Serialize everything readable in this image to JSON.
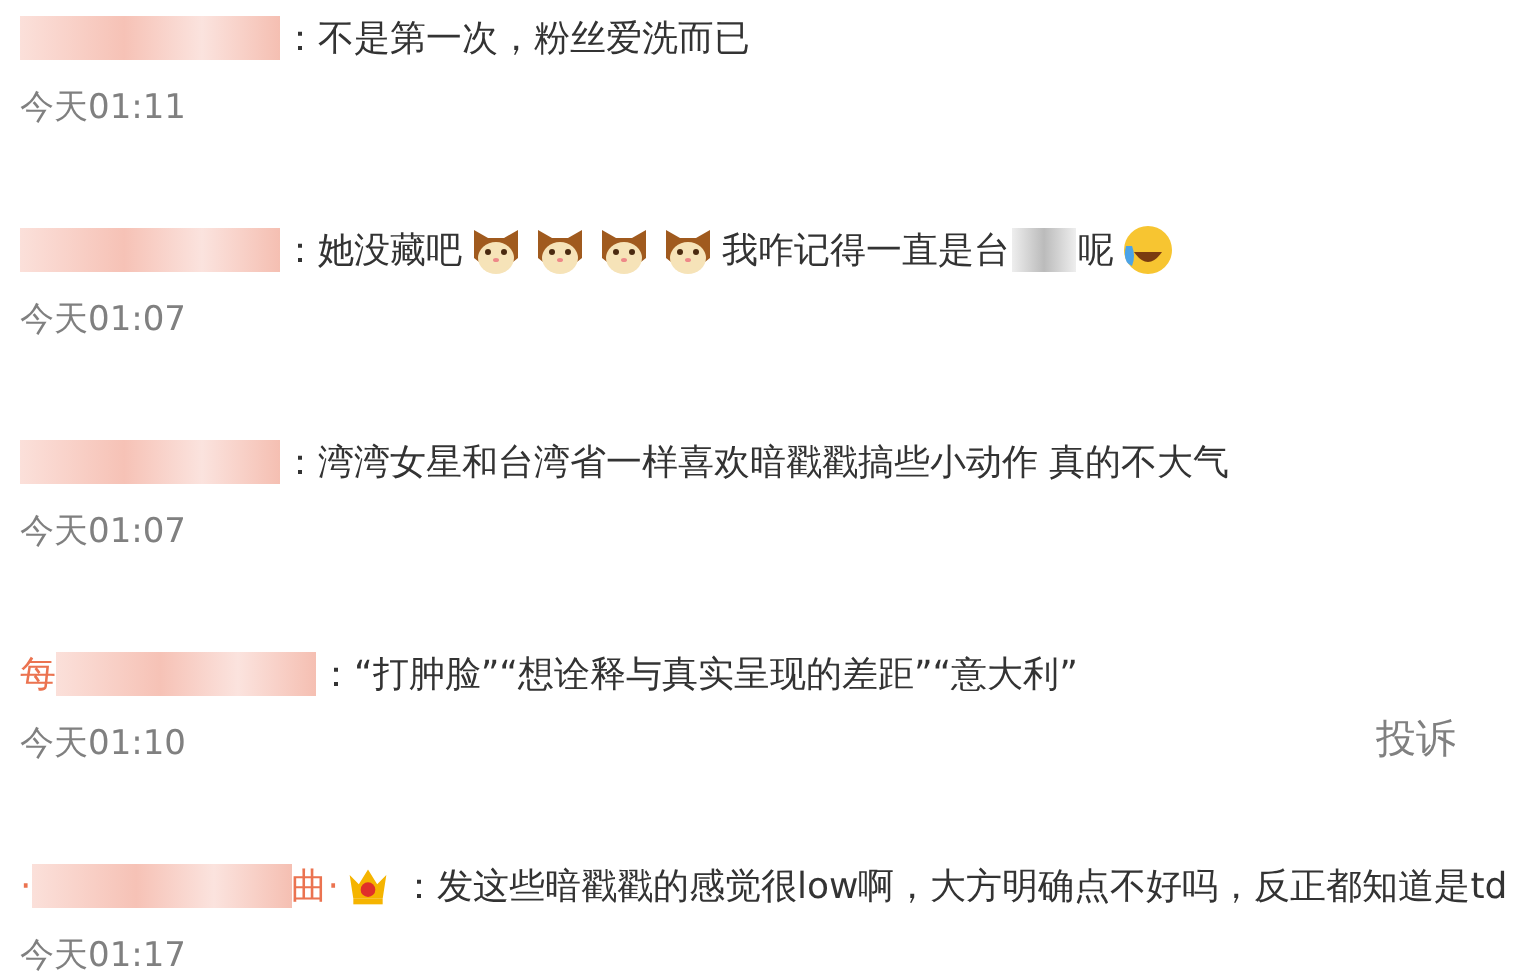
{
  "comments": [
    {
      "body": [
        {
          "kind": "text",
          "text": "：不是第一次，粉丝爱洗而已"
        }
      ],
      "time": "今天01:11"
    },
    {
      "body": [
        {
          "kind": "text",
          "text": "：她没藏吧"
        },
        {
          "kind": "cat"
        },
        {
          "kind": "cat"
        },
        {
          "kind": "cat"
        },
        {
          "kind": "cat"
        },
        {
          "kind": "text",
          "text": "我咋记得一直是台"
        },
        {
          "kind": "blur"
        },
        {
          "kind": "text",
          "text": "呢"
        },
        {
          "kind": "laugh"
        }
      ],
      "time": "今天01:07"
    },
    {
      "body": [
        {
          "kind": "text",
          "text": "：湾湾女星和台湾省一样喜欢暗戳戳搞些小动作 真的不大气"
        }
      ],
      "time": "今天01:07"
    },
    {
      "name_prefix": "每",
      "body": [
        {
          "kind": "text",
          "text": "：“打肿脸”“想诠释与真实呈现的差距”“意大利”"
        }
      ],
      "time": "今天01:10",
      "report": "投诉"
    },
    {
      "name_prefix": "·",
      "name_suffix": "曲·",
      "body": [
        {
          "kind": "crown"
        },
        {
          "kind": "text",
          "text": "：发这些暗戳戳的感觉很low啊，大方明确点不好吗，反正都知道是td"
        }
      ],
      "time": "今天01:17"
    }
  ]
}
